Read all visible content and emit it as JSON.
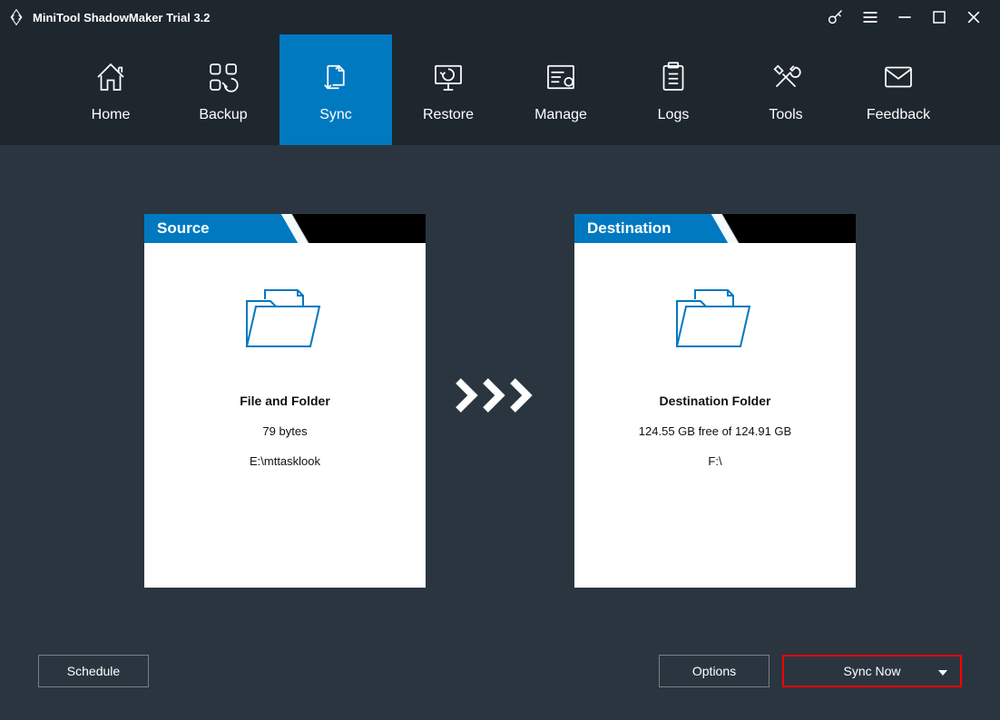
{
  "window": {
    "title": "MiniTool ShadowMaker Trial 3.2"
  },
  "nav": {
    "items": [
      {
        "label": "Home",
        "icon": "house"
      },
      {
        "label": "Backup",
        "icon": "grid-sync"
      },
      {
        "label": "Sync",
        "icon": "pages-sync",
        "active": true
      },
      {
        "label": "Restore",
        "icon": "restore"
      },
      {
        "label": "Manage",
        "icon": "manage"
      },
      {
        "label": "Logs",
        "icon": "logs"
      },
      {
        "label": "Tools",
        "icon": "tools"
      },
      {
        "label": "Feedback",
        "icon": "feedback"
      }
    ]
  },
  "source": {
    "header": "Source",
    "title": "File and Folder",
    "size": "79 bytes",
    "path": "E:\\mttasklook"
  },
  "destination": {
    "header": "Destination",
    "title": "Destination Folder",
    "space": "124.55 GB free of 124.91 GB",
    "path": "F:\\"
  },
  "footer": {
    "schedule_label": "Schedule",
    "options_label": "Options",
    "syncnow_label": "Sync Now"
  }
}
